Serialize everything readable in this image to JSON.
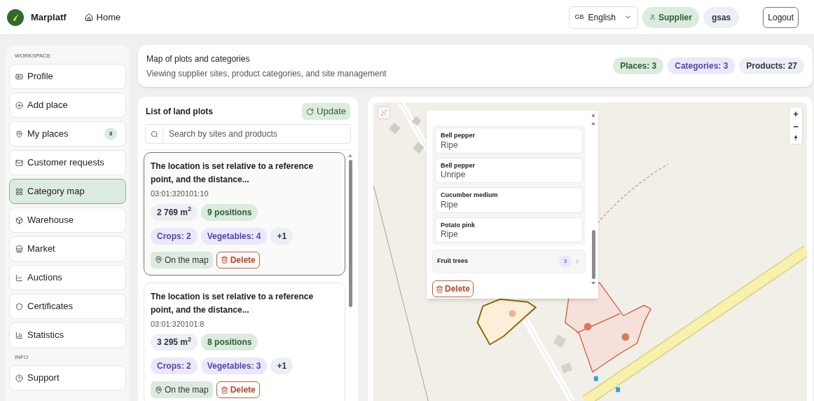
{
  "header": {
    "logo_text": "Marplatf",
    "home": "Home",
    "language_flag": "GB",
    "language": "English",
    "role": "Supplier",
    "user": "gsas",
    "logout": "Logout"
  },
  "sidebar": {
    "sections": [
      {
        "title": "WORKSPACE",
        "items": [
          {
            "label": "Profile",
            "selected": false
          },
          {
            "label": "Add place",
            "selected": false
          },
          {
            "label": "My places",
            "selected": false,
            "badge": "3"
          },
          {
            "label": "Customer requests",
            "selected": false
          },
          {
            "label": "Category map",
            "selected": true
          },
          {
            "label": "Warehouse",
            "selected": false
          },
          {
            "label": "Market",
            "selected": false
          },
          {
            "label": "Auctions",
            "selected": false
          },
          {
            "label": "Certificates",
            "selected": false
          },
          {
            "label": "Statistics",
            "selected": false
          }
        ]
      },
      {
        "title": "INFO",
        "items": [
          {
            "label": "Support",
            "selected": false
          }
        ]
      }
    ]
  },
  "page_header": {
    "title": "Map of plots and categories",
    "subtitle": "Viewing supplier sites, product categories, and site management",
    "stats": [
      {
        "label": "Places: 3",
        "color": "#dcebdf"
      },
      {
        "label": "Categories: 3",
        "color": "#ebe8fb"
      },
      {
        "label": "Products: 27",
        "color": "#eceff3"
      }
    ]
  },
  "plots_panel": {
    "title": "List of land plots",
    "update": "Update",
    "search": {
      "placeholder": "Search by sites and products"
    },
    "plots": [
      {
        "title": "The location is set relative to a reference point, and the distance...",
        "number": "03:01:320101:10",
        "area": "2 769 m$^{2}$",
        "positions": "9 positions",
        "tags": [
          {
            "label": "Crops: 2",
            "kind": "category"
          },
          {
            "label": "Vegetables: 4",
            "kind": "category"
          },
          {
            "label": "+1",
            "kind": "more"
          }
        ],
        "map_button": "On the map",
        "delete": "Delete",
        "selected": true
      },
      {
        "title": "The location is set relative to a reference point, and the distance...",
        "number": "03:01:320101:8",
        "area": "3 295 m$^{2}$",
        "positions": "8 positions",
        "tags": [
          {
            "label": "Crops: 2",
            "kind": "category"
          },
          {
            "label": "Vegetables: 3",
            "kind": "category"
          },
          {
            "label": "+1",
            "kind": "more"
          }
        ],
        "map_button": "On the map",
        "delete": "Delete",
        "selected": false
      }
    ]
  },
  "map": {
    "zoom_in": "+",
    "zoom_out": "−",
    "popup": {
      "close": "×",
      "products": [
        {
          "name": "Bell pepper",
          "state": "Ripe"
        },
        {
          "name": "Bell pepper",
          "state": "Unripe"
        },
        {
          "name": "Cucumber medium",
          "state": "Ripe"
        },
        {
          "name": "Potato pink",
          "state": "Ripe"
        }
      ],
      "groups": [
        {
          "name": "Fruit trees",
          "count": "3"
        }
      ],
      "delete": "Delete"
    }
  }
}
